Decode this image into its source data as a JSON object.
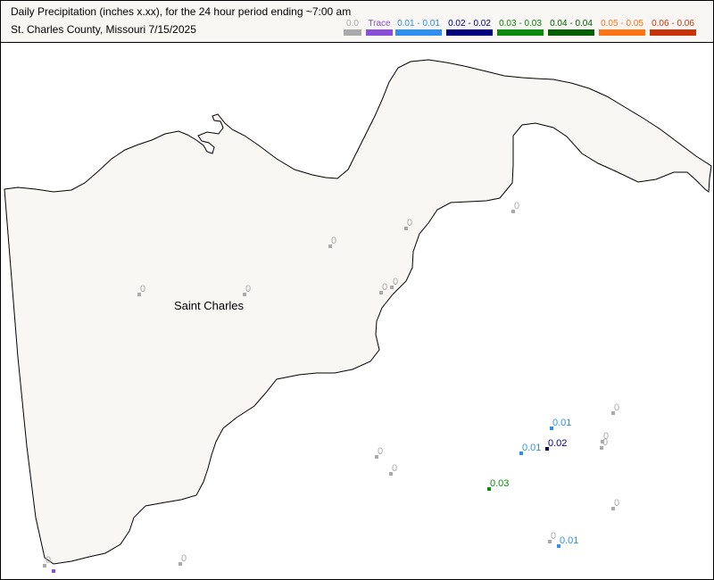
{
  "title_line1": "Daily Precipitation (inches  x.xx),  for the 24 hour period ending ~7:00 am",
  "title_line2": "St. Charles County, Missouri  7/15/2025",
  "legend": [
    {
      "label": "0.0",
      "color": "#aaaaaa"
    },
    {
      "label": "Trace",
      "color": "#8a4fd8"
    },
    {
      "label": "0.01 - 0.01",
      "color": "#2f8fef"
    },
    {
      "label": "0.02 - 0.02",
      "color": "#00007f"
    },
    {
      "label": "0.03 - 0.03",
      "color": "#0b8a0b"
    },
    {
      "label": "0.04 - 0.04",
      "color": "#005f00"
    },
    {
      "label": "0.05 - 0.05",
      "color": "#ff7414"
    },
    {
      "label": "0.06 - 0.06",
      "color": "#c8330a"
    }
  ],
  "county": {
    "name": "Saint Charles",
    "fill": "#f8f7f4"
  },
  "stations": [
    {
      "value": "0",
      "cls": 0
    },
    {
      "value": "0",
      "cls": 0
    },
    {
      "value": "0",
      "cls": 0
    },
    {
      "value": "0",
      "cls": 0
    },
    {
      "value": "0",
      "cls": 0
    },
    {
      "value": "0",
      "cls": 0
    },
    {
      "value": "0",
      "cls": 0
    },
    {
      "value": "0.01",
      "cls": 2
    },
    {
      "value": "0",
      "cls": 0
    },
    {
      "value": "0.01",
      "cls": 2
    },
    {
      "value": "0.02",
      "cls": 3
    },
    {
      "value": "0",
      "cls": 0
    },
    {
      "value": "0",
      "cls": 0
    },
    {
      "value": "0",
      "cls": 0
    },
    {
      "value": "0",
      "cls": 0
    },
    {
      "value": "0.03",
      "cls": 4
    },
    {
      "value": "0",
      "cls": 0
    },
    {
      "value": "0",
      "cls": 0
    },
    {
      "value": "0.01",
      "cls": 2
    },
    {
      "value": "0",
      "cls": 0
    },
    {
      "value": "0",
      "cls": 0
    },
    {
      "value": "",
      "cls": 1
    }
  ]
}
